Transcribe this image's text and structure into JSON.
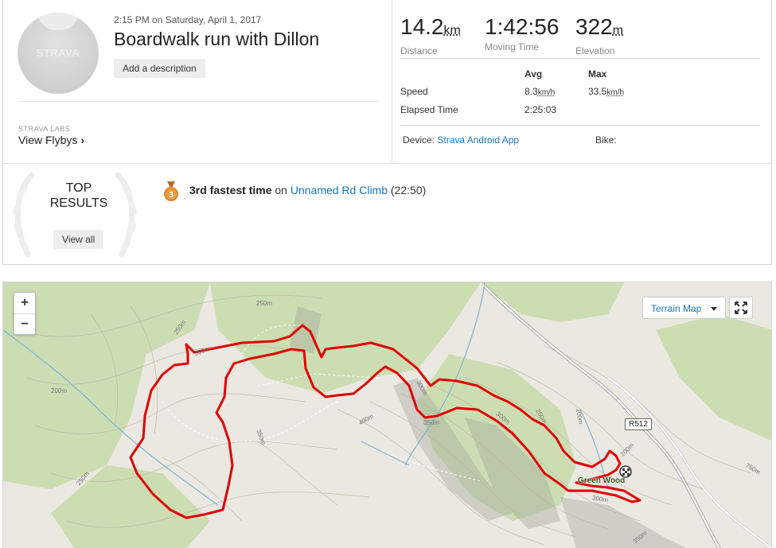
{
  "activity": {
    "avatar_logo": "STRAVA",
    "date": "2:15 PM on Saturday, April 1, 2017",
    "title": "Boardwalk run with Dillon",
    "add_description": "Add a description",
    "labs_label": "STRAVA LABS",
    "flybys_label": "View Flybys"
  },
  "stats": {
    "distance": {
      "value": "14.2",
      "unit": "km",
      "label": "Distance"
    },
    "moving_time": {
      "value": "1:42:56",
      "label": "Moving Time"
    },
    "elevation": {
      "value": "322",
      "unit": "m",
      "label": "Elevation"
    }
  },
  "details": {
    "avg_header": "Avg",
    "max_header": "Max",
    "speed_label": "Speed",
    "speed_avg": "8.3",
    "speed_max": "33.5",
    "speed_unit": "km/h",
    "elapsed_label": "Elapsed Time",
    "elapsed_value": "2:25:03",
    "device_label": "Device:",
    "device_value": "Strava Android App",
    "bike_label": "Bike:"
  },
  "results": {
    "title_line1": "TOP",
    "title_line2": "RESULTS",
    "view_all": "View all",
    "medal_rank": "3",
    "achievement_bold": "3rd fastest time",
    "achievement_on": "on",
    "segment_name": "Unnamed Rd Climb",
    "segment_time": "(22:50)"
  },
  "map": {
    "zoom_in": "+",
    "zoom_out": "−",
    "terrain_label": "Terrain Map",
    "road_label": "R512",
    "place_label": "Green Wood",
    "contour_labels": [
      "250m",
      "250m",
      "300m",
      "200m",
      "350m",
      "400m",
      "300m",
      "350m",
      "300m",
      "250m",
      "200m",
      "200m",
      "250m",
      "300m",
      "750m",
      "350m"
    ],
    "route_color": "#e00000",
    "forest_color": "#c5dba5"
  }
}
